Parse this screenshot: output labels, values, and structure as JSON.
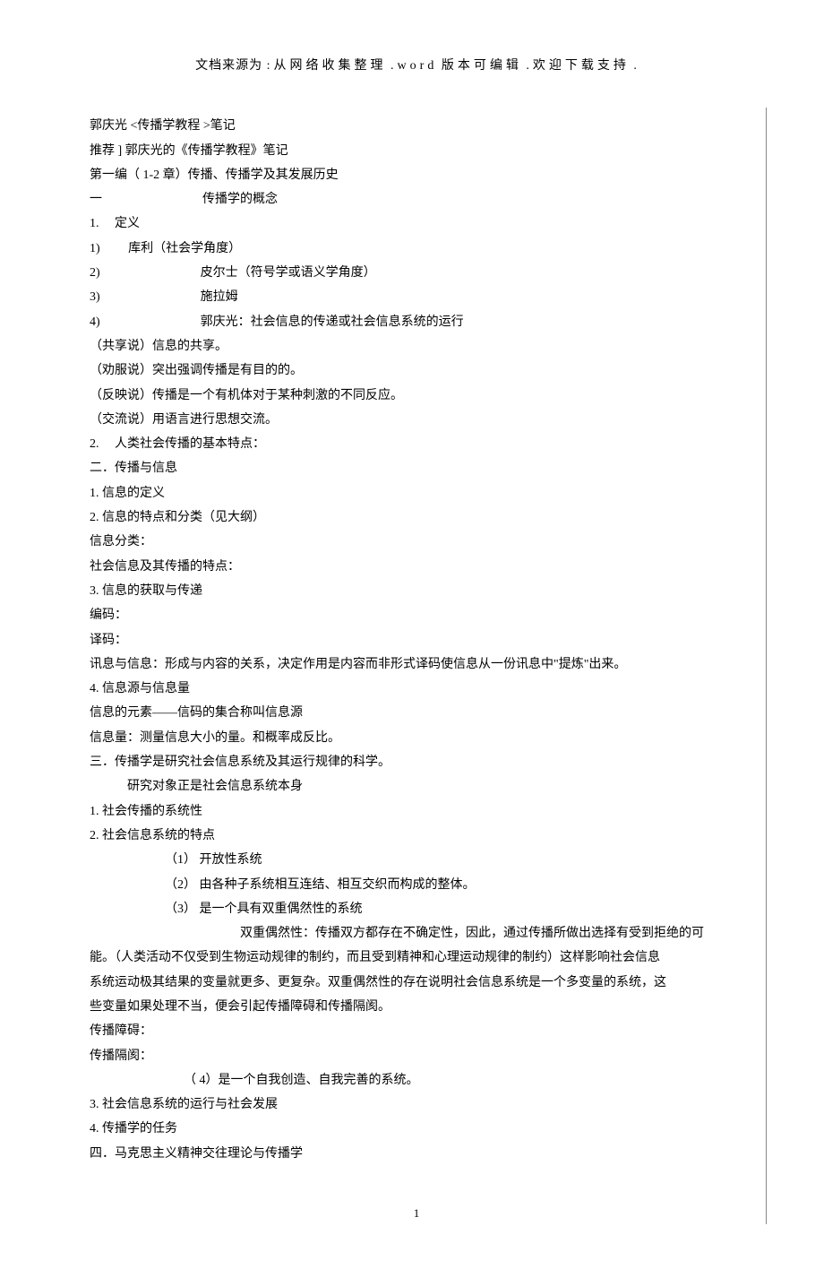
{
  "header": {
    "prefix": "文档来源为",
    "middle": ":从网络收集整理",
    "word": ".word",
    "editable": "版本可编辑",
    "welcome": ".欢迎下载支持",
    "dot": "."
  },
  "lines": [
    {
      "cls": "",
      "text": "郭庆光 <传播学教程 >笔记"
    },
    {
      "cls": "",
      "text": "推荐 ] 郭庆光的《传播学教程》笔记"
    },
    {
      "cls": "",
      "text": "第一编（ 1-2 章）传播、传播学及其发展历史"
    },
    {
      "cls": "",
      "text": "一　　　　　　　　传播学的概念"
    },
    {
      "cls": "",
      "text": "1.　 定义"
    },
    {
      "cls": "",
      "text": "1)　　 库利（社会学角度）"
    },
    {
      "cls": "",
      "text": "2)　　　　　　　　皮尔士（符号学或语义学角度）"
    },
    {
      "cls": "",
      "text": "3)　　　　　　　　施拉姆"
    },
    {
      "cls": "",
      "text": "4)　　　　　　　　郭庆光：社会信息的传递或社会信息系统的运行"
    },
    {
      "cls": "",
      "text": "（共享说）信息的共享。"
    },
    {
      "cls": "",
      "text": "（劝服说）突出强调传播是有目的的。"
    },
    {
      "cls": "",
      "text": "（反映说）传播是一个有机体对于某种刺激的不同反应。"
    },
    {
      "cls": "",
      "text": "（交流说）用语言进行思想交流。"
    },
    {
      "cls": "",
      "text": "2.　 人类社会传播的基本特点："
    },
    {
      "cls": "",
      "text": "二．传播与信息"
    },
    {
      "cls": "",
      "text": "1. 信息的定义"
    },
    {
      "cls": "",
      "text": "2. 信息的特点和分类（见大纲）"
    },
    {
      "cls": "",
      "text": "信息分类："
    },
    {
      "cls": "",
      "text": "社会信息及其传播的特点："
    },
    {
      "cls": "",
      "text": "3. 信息的获取与传递"
    },
    {
      "cls": "",
      "text": "编码："
    },
    {
      "cls": "",
      "text": "译码："
    },
    {
      "cls": "",
      "text": "讯息与信息：形成与内容的关系，决定作用是内容而非形式译码使信息从一份讯息中\"提炼\"出来。"
    },
    {
      "cls": "",
      "text": "4. 信息源与信息量"
    },
    {
      "cls": "",
      "text": "信息的元素——信码的集合称叫信息源"
    },
    {
      "cls": "",
      "text": "信息量：测量信息大小的量。和概率成反比。"
    },
    {
      "cls": "",
      "text": "三．传播学是研究社会信息系统及其运行规律的科学。"
    },
    {
      "cls": "indent-1",
      "text": "研究对象正是社会信息系统本身"
    },
    {
      "cls": "",
      "text": "1. 社会传播的系统性"
    },
    {
      "cls": "",
      "text": "2. 社会信息系统的特点"
    },
    {
      "cls": "indent-2",
      "text": "（1） 开放性系统"
    },
    {
      "cls": "indent-2",
      "text": "（2） 由各种子系统相互连结、相互交织而构成的整体。"
    },
    {
      "cls": "indent-2",
      "text": "（3） 是一个具有双重偶然性的系统"
    },
    {
      "cls": "indent-3",
      "text": "　　　　双重偶然性：传播双方都存在不确定性，因此，通过传播所做出选择有受到拒绝的可"
    },
    {
      "cls": "",
      "text": "能。（人类活动不仅受到生物运动规律的制约，而且受到精神和心理运动规律的制约）这样影响社会信息"
    },
    {
      "cls": "",
      "text": "系统运动极其结果的变量就更多、更复杂。双重偶然性的存在说明社会信息系统是一个多变量的系统，这"
    },
    {
      "cls": "",
      "text": "些变量如果处理不当，便会引起传播障碍和传播隔阂。"
    },
    {
      "cls": "",
      "text": "传播障碍："
    },
    {
      "cls": "",
      "text": "传播隔阂："
    },
    {
      "cls": "indent-2",
      "text": "　　（ 4）是一个自我创造、自我完善的系统。"
    },
    {
      "cls": "",
      "text": "3. 社会信息系统的运行与社会发展"
    },
    {
      "cls": "",
      "text": "4. 传播学的任务"
    },
    {
      "cls": "",
      "text": "四．马克思主义精神交往理论与传播学"
    }
  ],
  "page_number": "1"
}
